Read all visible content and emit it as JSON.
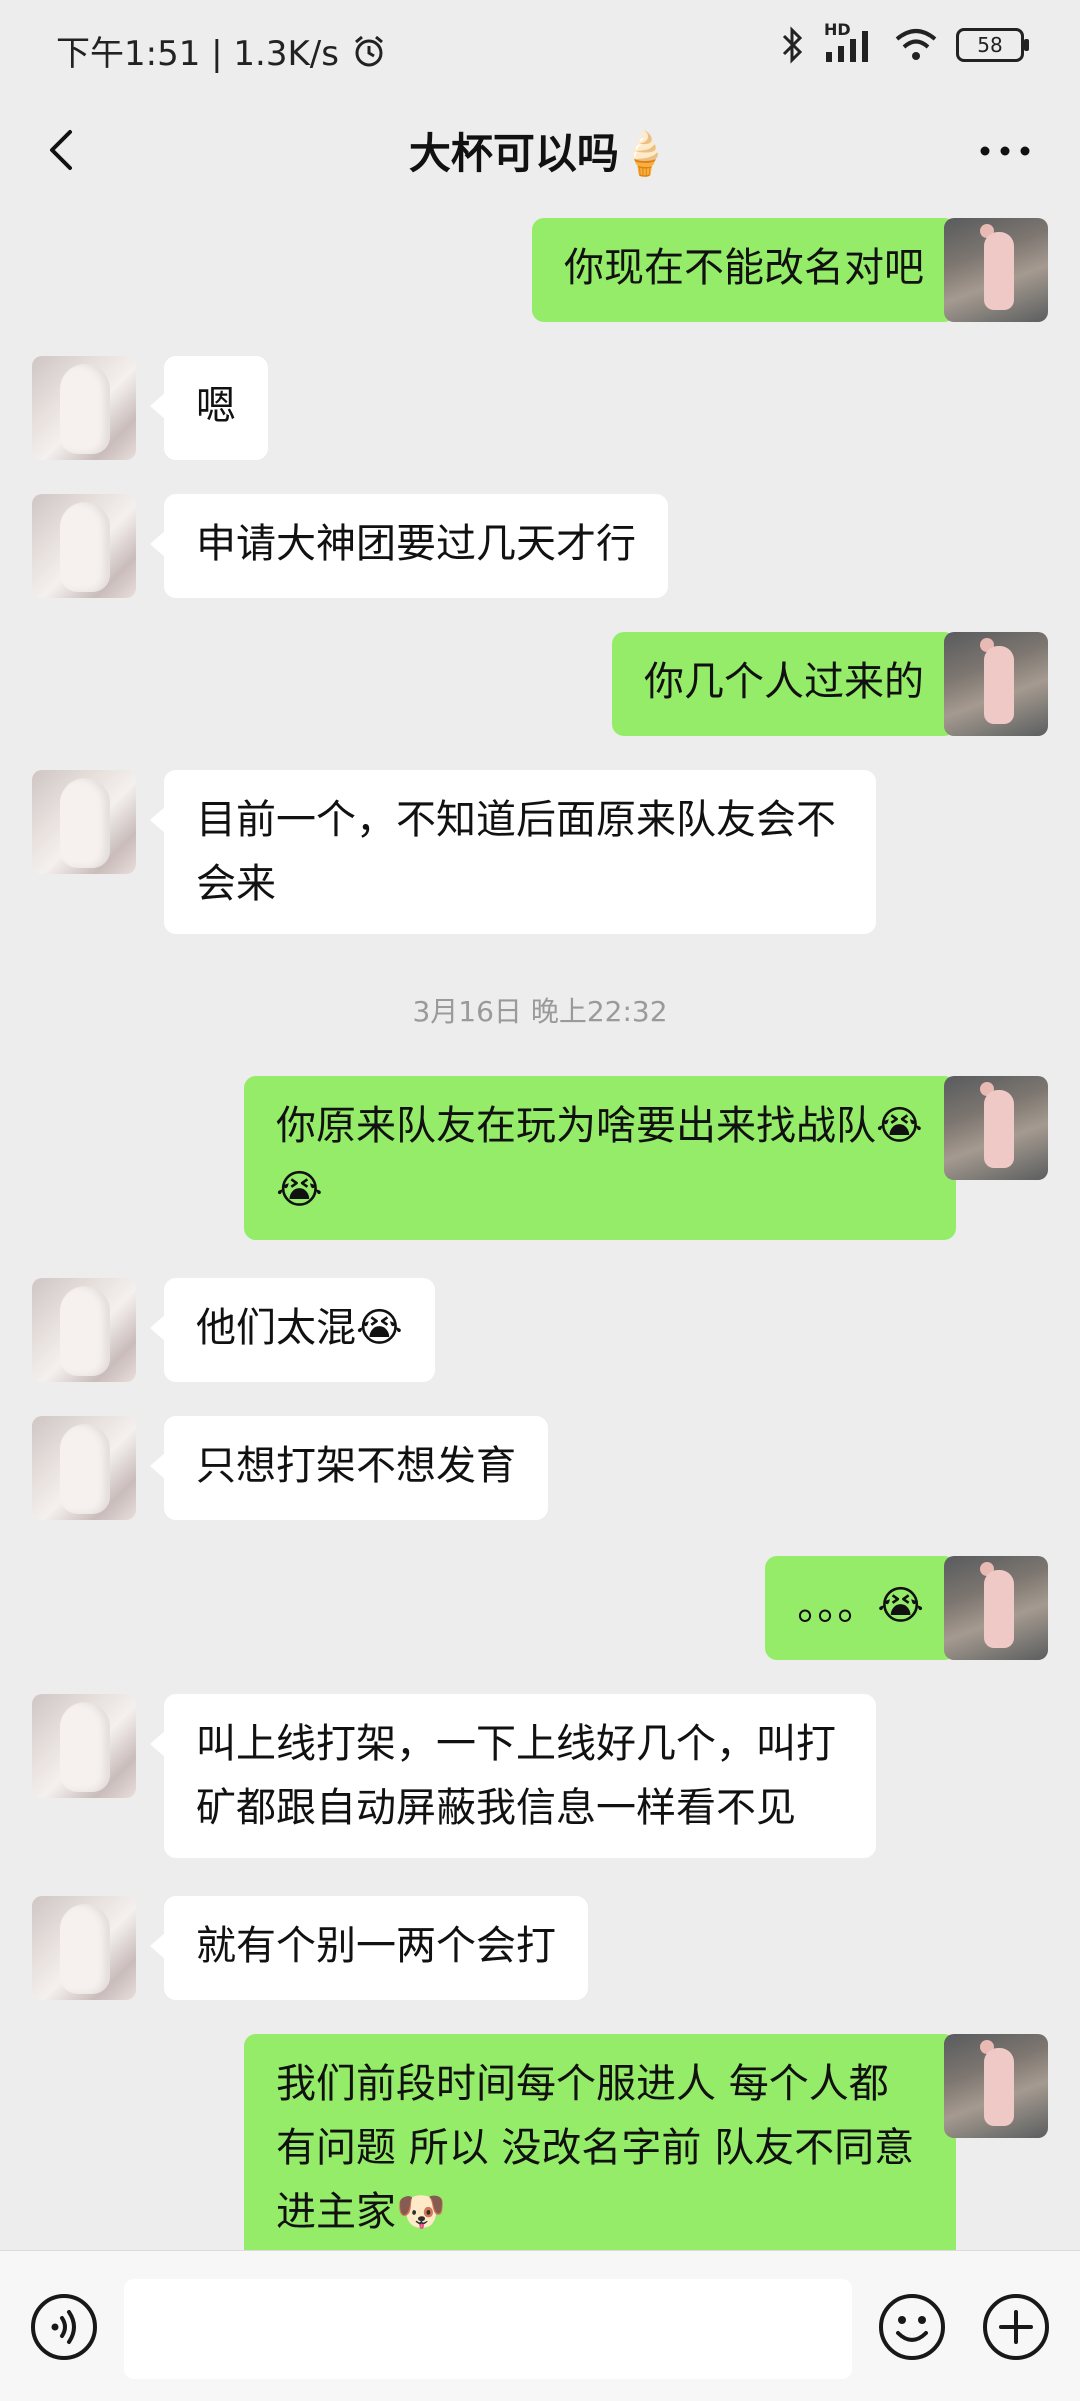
{
  "status_bar": {
    "time_speed": "下午1:51 | 1.3K/s",
    "battery": "58",
    "network_label": "HD"
  },
  "header": {
    "title": "大杯可以吗🍦"
  },
  "messages": [
    {
      "side": "right",
      "text": "你现在不能改名对吧"
    },
    {
      "side": "left",
      "text": "嗯"
    },
    {
      "side": "left",
      "text": "申请大神团要过几天才行"
    },
    {
      "side": "right",
      "text": "你几个人过来的"
    },
    {
      "side": "left",
      "text": "目前一个，不知道后面原来队友会不会来"
    },
    {
      "side": "right",
      "text": "你原来队友在玩为啥要出来找战队😭😭"
    },
    {
      "side": "left",
      "text": "他们太混😭"
    },
    {
      "side": "left",
      "text": "只想打架不想发育"
    },
    {
      "side": "right",
      "text": "。。。😭"
    },
    {
      "side": "left",
      "text": "叫上线打架，一下上线好几个，叫打矿都跟自动屏蔽我信息一样看不见"
    },
    {
      "side": "left",
      "text": "就有个别一两个会打"
    },
    {
      "side": "right",
      "text": "我们前段时间每个服进人 每个人都有问题 所以 没改名字前 队友不同意进主家🐶"
    }
  ],
  "timestamp": "3月16日 晚上22:32",
  "colors": {
    "background": "#ededed",
    "bubble_self": "#95ec69",
    "bubble_other": "#ffffff",
    "timestamp": "#9a9a9a"
  },
  "icons": {
    "back": "chevron-left-icon",
    "more": "more-dots-icon",
    "voice": "voice-icon",
    "emoji": "emoji-smile-icon",
    "plus": "plus-circle-icon"
  }
}
